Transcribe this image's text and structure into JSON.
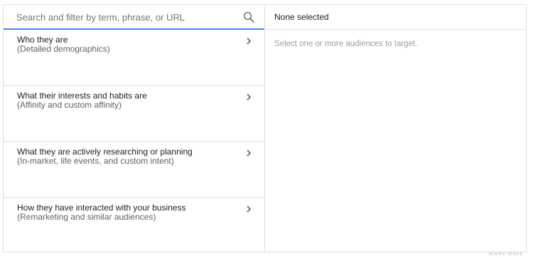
{
  "search": {
    "placeholder": "Search and filter by term, phrase, or URL",
    "value": ""
  },
  "categories": [
    {
      "title": "Who they are",
      "subtitle": "(Detailed demographics)"
    },
    {
      "title": "What their interests and habits are",
      "subtitle": "(Affinity and custom affinity)"
    },
    {
      "title": "What they are actively researching or planning",
      "subtitle": "(In-market, life events, and custom intent)"
    },
    {
      "title": "How they have interacted with your business",
      "subtitle": "(Remarketing and similar audiences)"
    }
  ],
  "selection": {
    "header": "None selected",
    "empty_message": "Select one or more audiences to target."
  },
  "watermark": "alamy stock",
  "colors": {
    "accent": "#4285f4",
    "border": "#e0e0e0",
    "text": "#202124",
    "secondary_text": "#5f6368",
    "hint_text": "#9aa0a6"
  },
  "icons": {
    "search": "search-icon",
    "chevron": "chevron-right-icon"
  }
}
